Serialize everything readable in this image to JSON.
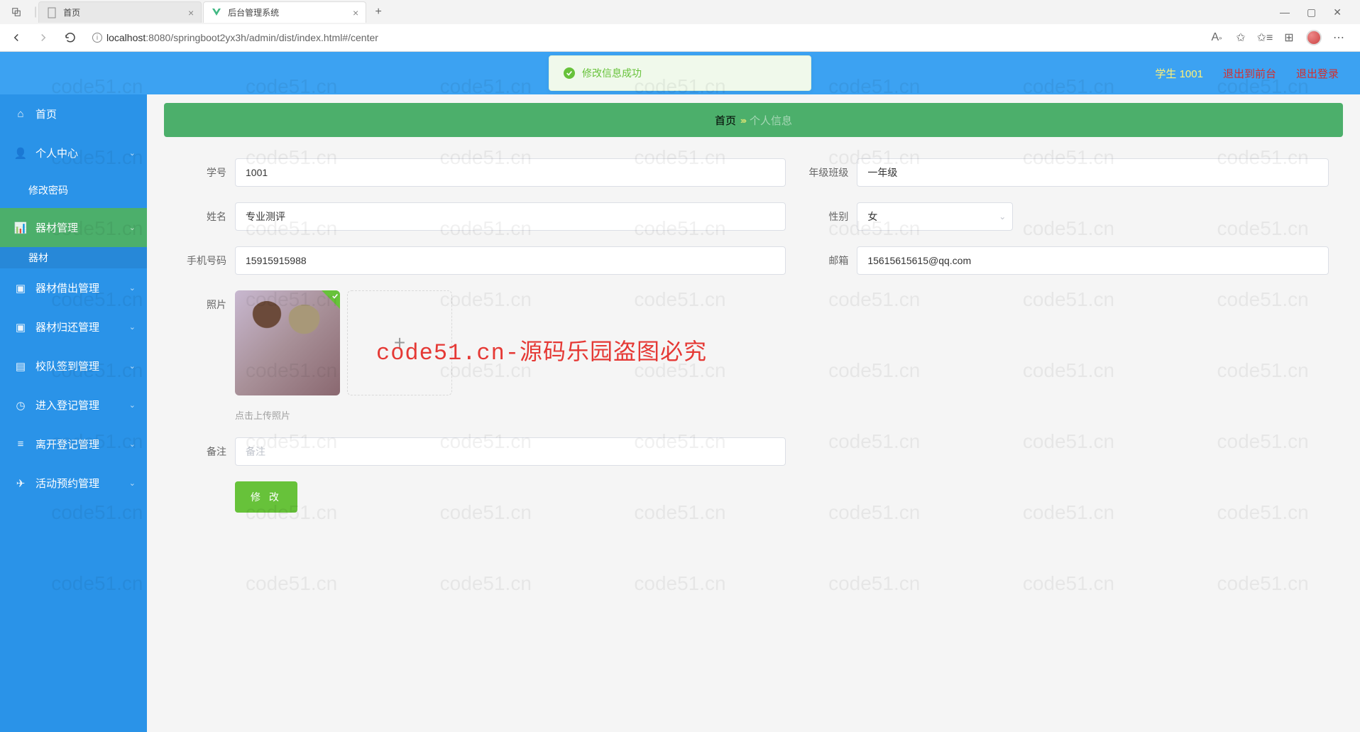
{
  "browser": {
    "tabs": [
      {
        "title": "首页"
      },
      {
        "title": "后台管理系统"
      }
    ],
    "url_host": "localhost",
    "url_port": ":8080",
    "url_path": "/springboot2yx3h/admin/dist/index.html#/center"
  },
  "header": {
    "user_label": "学生 1001",
    "exit_front": "退出到前台",
    "logout": "退出登录"
  },
  "toast": {
    "message": "修改信息成功"
  },
  "sidebar": {
    "items": [
      {
        "label": "首页",
        "icon": "home"
      },
      {
        "label": "个人中心",
        "icon": "user"
      },
      {
        "label": "器材管理",
        "icon": "chart"
      },
      {
        "label": "器材借出管理",
        "icon": "box"
      },
      {
        "label": "器材归还管理",
        "icon": "box"
      },
      {
        "label": "校队签到管理",
        "icon": "check"
      },
      {
        "label": "进入登记管理",
        "icon": "clock"
      },
      {
        "label": "离开登记管理",
        "icon": "menu"
      },
      {
        "label": "活动预约管理",
        "icon": "plane"
      }
    ],
    "sub_change_pwd": "修改密码",
    "sub_equipment": "器材"
  },
  "breadcrumb": {
    "home": "首页",
    "current": "个人信息"
  },
  "form": {
    "student_id": {
      "label": "学号",
      "value": "1001"
    },
    "grade": {
      "label": "年级班级",
      "value": "一年级"
    },
    "name": {
      "label": "姓名",
      "value": "专业测评"
    },
    "gender": {
      "label": "性别",
      "value": "女"
    },
    "phone": {
      "label": "手机号码",
      "value": "15915915988"
    },
    "email": {
      "label": "邮箱",
      "value": "15615615615@qq.com"
    },
    "photo": {
      "label": "照片",
      "hint": "点击上传照片"
    },
    "remark": {
      "label": "备注",
      "value": "",
      "placeholder": "备注"
    },
    "submit": "修 改"
  },
  "watermark": {
    "text": "code51.cn",
    "big": "code51.cn-源码乐园盗图必究"
  }
}
